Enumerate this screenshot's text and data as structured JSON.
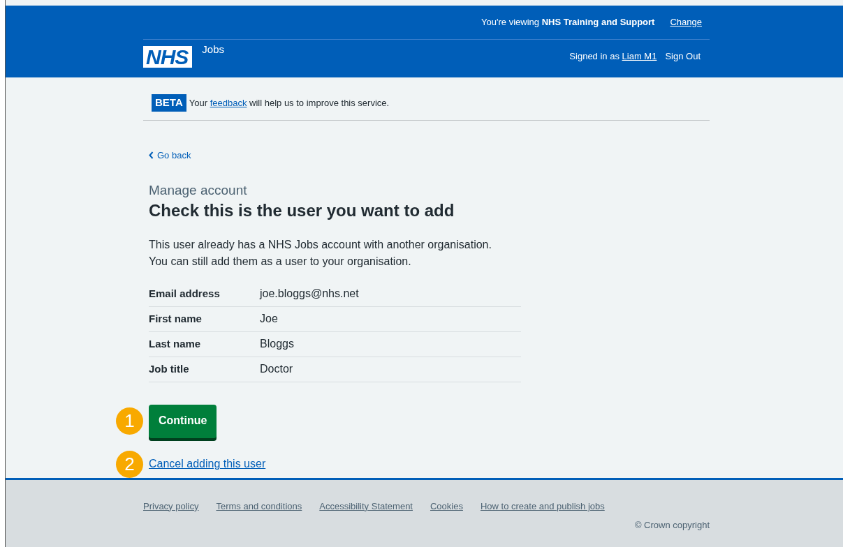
{
  "header": {
    "logo": "NHS",
    "service": "Jobs",
    "viewing": "You're viewing **NHS Training and Support**",
    "change_link": "Change",
    "signed_in_prefix": "Signed in as",
    "user_link": "Liam M1",
    "sign_out": "Sign Out"
  },
  "phase_banner": {
    "tag": "BETA",
    "text_before": "Your",
    "link": "feedback",
    "text_after": "will help us to improve this service."
  },
  "back_link": "Go back",
  "caption": "Manage account",
  "heading": "Check this is the user you want to add",
  "intro": "This user already has a NHS Jobs account with another organisation. You can still add them as a user to your organisation.",
  "summary": [
    {
      "key": "Email address",
      "value": "joe.bloggs@nhs.net"
    },
    {
      "key": "First name",
      "value": "Joe"
    },
    {
      "key": "Last name",
      "value": "Bloggs"
    },
    {
      "key": "Job title",
      "value": "Doctor"
    }
  ],
  "continue_button": {
    "label": "Continue",
    "callout": "1"
  },
  "cancel_link": {
    "label": "Cancel adding this user",
    "callout": "2"
  },
  "footer": {
    "links": [
      "Privacy policy",
      "Terms and conditions",
      "Accessibility Statement",
      "Cookies",
      "How to create and publish jobs"
    ],
    "copyright": "© Crown copyright"
  }
}
